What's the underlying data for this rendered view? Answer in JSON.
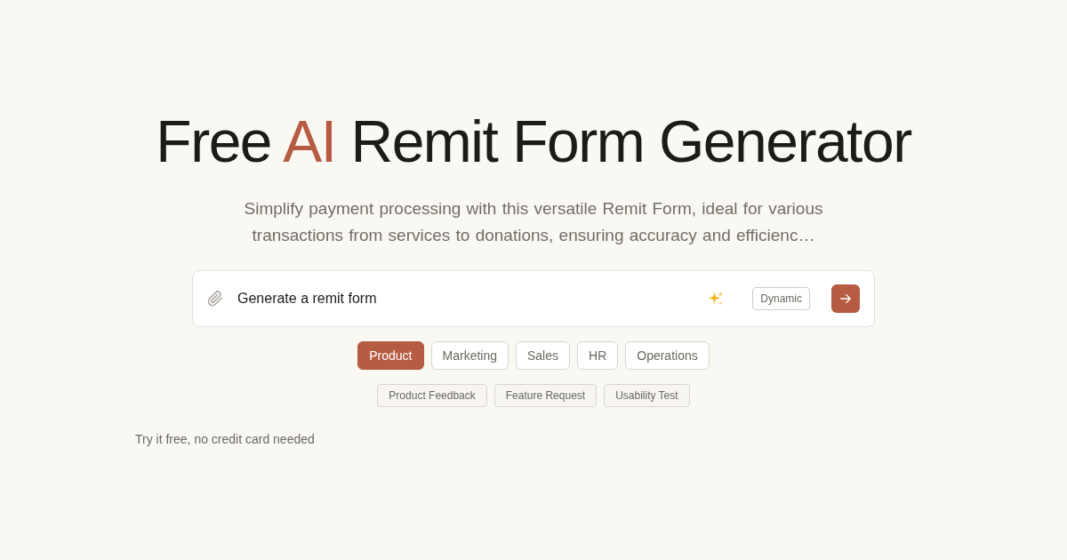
{
  "hero": {
    "title": {
      "before": "Free",
      "highlight": "AI",
      "after": "Remit Form Generator"
    },
    "subtitle": "Simplify payment processing with this versatile Remit Form, ideal for various transactions from services to donations, ensuring accuracy and efficienc…"
  },
  "prompt": {
    "value": "Generate a remit form",
    "mode": "Dynamic"
  },
  "categories": [
    {
      "label": "Product",
      "selected": true
    },
    {
      "label": "Marketing",
      "selected": false
    },
    {
      "label": "Sales",
      "selected": false
    },
    {
      "label": "HR",
      "selected": false
    },
    {
      "label": "Operations",
      "selected": false
    }
  ],
  "templates": [
    "Product Feedback",
    "Feature Request",
    "Usability Test"
  ],
  "footnote": "Try it free, no credit card needed"
}
